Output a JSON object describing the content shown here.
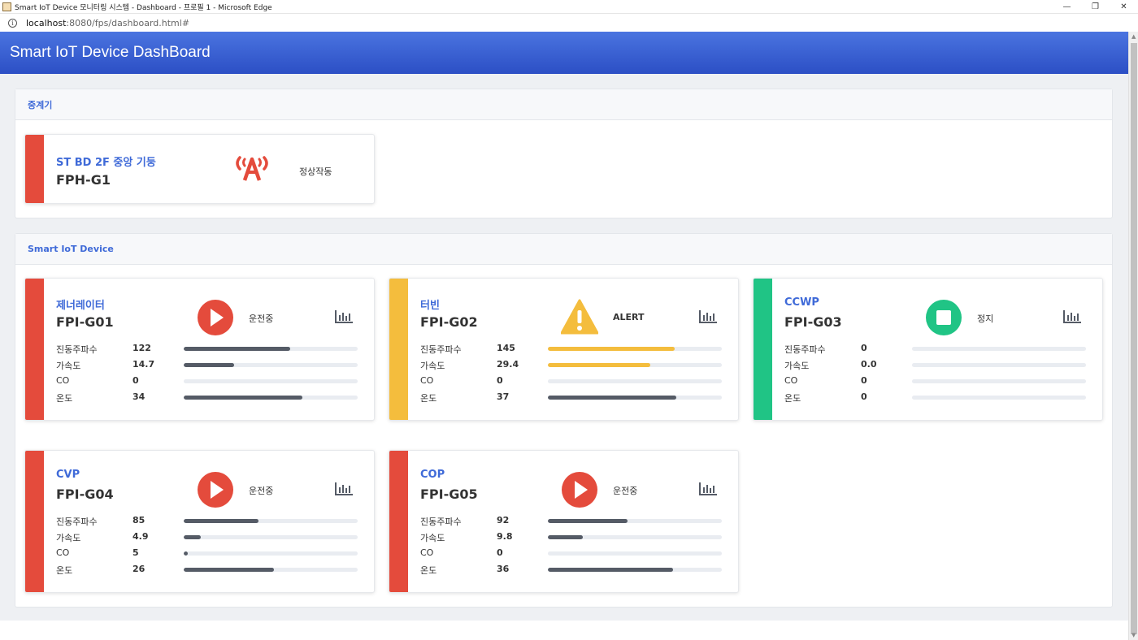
{
  "window": {
    "title": "Smart IoT Device 모니터링 시스템 - Dashboard - 프로필 1 - Microsoft Edge",
    "minimize": "—",
    "restore": "❐",
    "close": "✕"
  },
  "address": {
    "host": "localhost",
    "rest": ":8080/fps/dashboard.html#"
  },
  "header": {
    "title": "Smart IoT Device DashBoard"
  },
  "relay_section": {
    "title": "중계기",
    "card": {
      "name": "ST BD 2F 중앙 기둥",
      "id": "FPH-G1",
      "icon": "antenna-icon",
      "status": "정상작동",
      "accent": "#e44b3c"
    }
  },
  "device_section": {
    "title": "Smart IoT Device",
    "devices": [
      {
        "name": "제너레이터",
        "id": "FPI-G01",
        "status": "운전중",
        "status_icon": "play-icon",
        "accent": "#e44b3c",
        "metrics": [
          {
            "label": "진동주파수",
            "value": "122",
            "level": 0.61,
            "color": "#555b66"
          },
          {
            "label": "가속도",
            "value": "14.7",
            "level": 0.29,
            "color": "#555b66"
          },
          {
            "label": "CO",
            "value": "0",
            "level": 0,
            "color": "#555b66"
          },
          {
            "label": "온도",
            "value": "34",
            "level": 0.68,
            "color": "#555b66"
          }
        ]
      },
      {
        "name": "터빈",
        "id": "FPI-G02",
        "status": "ALERT",
        "status_icon": "warning-icon",
        "accent": "#f4bd3d",
        "metrics": [
          {
            "label": "진동주파수",
            "value": "145",
            "level": 0.73,
            "color": "#f4bd3d"
          },
          {
            "label": "가속도",
            "value": "29.4",
            "level": 0.59,
            "color": "#f4bd3d"
          },
          {
            "label": "CO",
            "value": "0",
            "level": 0,
            "color": "#555b66"
          },
          {
            "label": "온도",
            "value": "37",
            "level": 0.74,
            "color": "#555b66"
          }
        ]
      },
      {
        "name": "CCWP",
        "id": "FPI-G03",
        "status": "정지",
        "status_icon": "stop-icon",
        "accent": "#20c485",
        "metrics": [
          {
            "label": "진동주파수",
            "value": "0",
            "level": 0,
            "color": "#555b66"
          },
          {
            "label": "가속도",
            "value": "0.0",
            "level": 0,
            "color": "#555b66"
          },
          {
            "label": "CO",
            "value": "0",
            "level": 0,
            "color": "#555b66"
          },
          {
            "label": "온도",
            "value": "0",
            "level": 0,
            "color": "#555b66"
          }
        ]
      },
      {
        "name": "CVP",
        "id": "FPI-G04",
        "status": "운전중",
        "status_icon": "play-icon",
        "accent": "#e44b3c",
        "metrics": [
          {
            "label": "진동주파수",
            "value": "85",
            "level": 0.43,
            "color": "#555b66"
          },
          {
            "label": "가속도",
            "value": "4.9",
            "level": 0.1,
            "color": "#555b66"
          },
          {
            "label": "CO",
            "value": "5",
            "level": 0.025,
            "color": "#555b66"
          },
          {
            "label": "온도",
            "value": "26",
            "level": 0.52,
            "color": "#555b66"
          }
        ]
      },
      {
        "name": "COP",
        "id": "FPI-G05",
        "status": "운전중",
        "status_icon": "play-icon",
        "accent": "#e44b3c",
        "metrics": [
          {
            "label": "진동주파수",
            "value": "92",
            "level": 0.46,
            "color": "#555b66"
          },
          {
            "label": "가속도",
            "value": "9.8",
            "level": 0.2,
            "color": "#555b66"
          },
          {
            "label": "CO",
            "value": "0",
            "level": 0,
            "color": "#555b66"
          },
          {
            "label": "온도",
            "value": "36",
            "level": 0.72,
            "color": "#555b66"
          }
        ]
      }
    ]
  }
}
